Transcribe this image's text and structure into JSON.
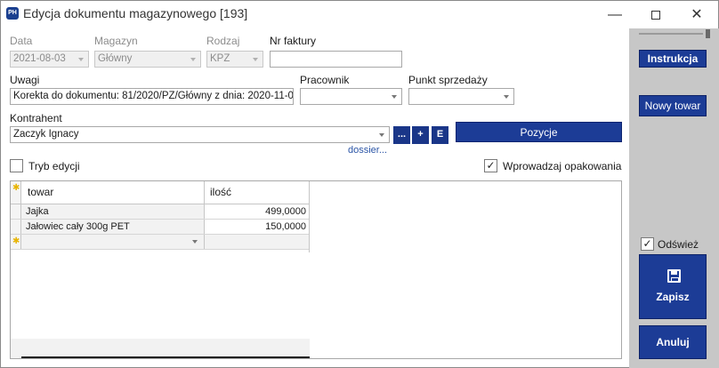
{
  "window": {
    "title": "Edycja dokumentu magazynowego [193]",
    "app_icon_text": "PH",
    "minimize": "—",
    "close": "✕"
  },
  "form": {
    "data": {
      "label": "Data",
      "value": "2021-08-03"
    },
    "magazyn": {
      "label": "Magazyn",
      "value": "Główny"
    },
    "rodzaj": {
      "label": "Rodzaj",
      "value": "KPZ"
    },
    "nr_faktury": {
      "label": "Nr faktury",
      "value": ""
    },
    "uwagi": {
      "label": "Uwagi",
      "value": "Korekta do dokumentu: 81/2020/PZ/Główny z dnia: 2020-11-0"
    },
    "pracownik": {
      "label": "Pracownik",
      "value": ""
    },
    "punkt_sprzedazy": {
      "label": "Punkt sprzedaży",
      "value": ""
    },
    "kontrahent": {
      "label": "Kontrahent",
      "value": "Zaczyk Ignacy"
    },
    "btn_more": "...",
    "btn_add": "+",
    "btn_edit": "E",
    "pozycje": "Pozycje",
    "dossier": "dossier...",
    "tryb_edycji": {
      "label": "Tryb edycji",
      "checked": false
    },
    "wprowadzaj_opakowania": {
      "label": "Wprowadzaj opakowania",
      "checked": true,
      "mark": "✓"
    }
  },
  "grid": {
    "columns": [
      "towar",
      "ilość"
    ],
    "rows": [
      {
        "towar": "Jajka",
        "ilosc": "499,0000"
      },
      {
        "towar": "Jałowiec cały 300g PET",
        "ilosc": "150,0000"
      }
    ],
    "new_row_marker": "✱"
  },
  "side": {
    "instrukcja": "Instrukcja",
    "nowy_towar": "Nowy towar",
    "odswiez": {
      "label": "Odśwież",
      "checked": true,
      "mark": "✓"
    },
    "zapisz": "Zapisz",
    "anuluj": "Anuluj"
  },
  "colors": {
    "accent": "#1c3c96",
    "side_panel": "#c7c7c7",
    "link": "#2b55a6"
  }
}
